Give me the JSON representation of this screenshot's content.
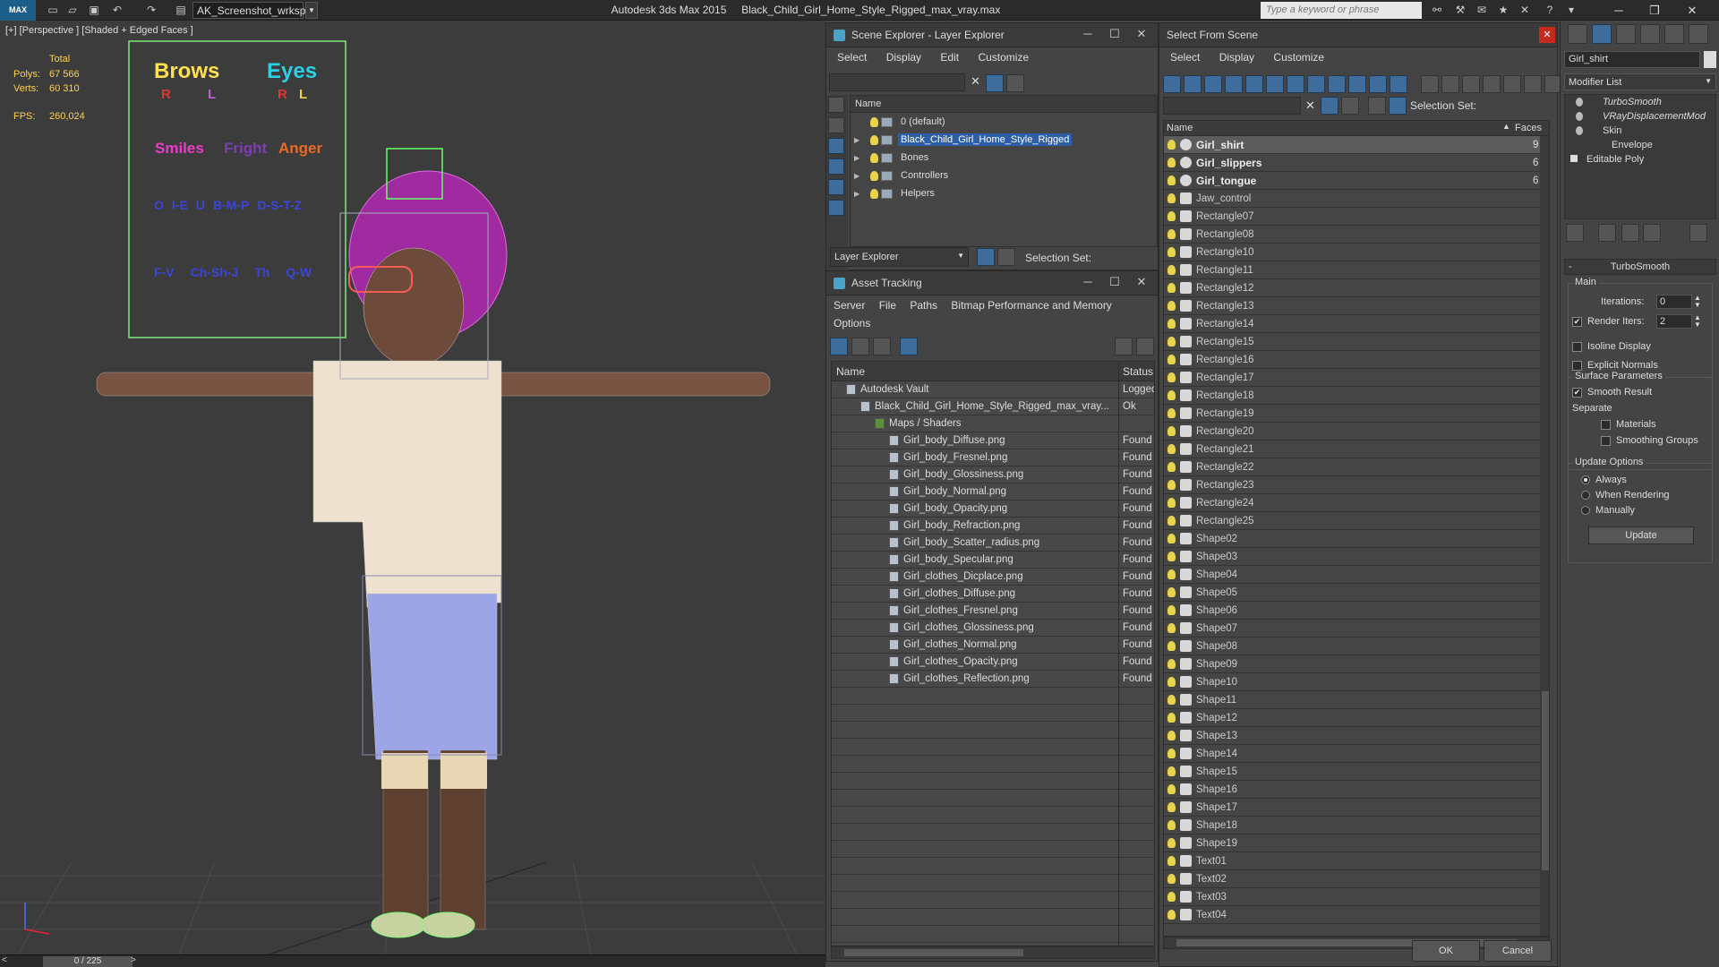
{
  "titlebar": {
    "logo": "MAX",
    "workspace": "AK_Screenshot_wrksp",
    "app_name": "Autodesk 3ds Max  2015",
    "file_name": "Black_Child_Girl_Home_Style_Rigged_max_vray.max",
    "search_placeholder": "Type a keyword or phrase"
  },
  "viewport": {
    "label": "[+] [Perspective ] [Shaded + Edged Faces ]",
    "stats": {
      "total_label": "Total",
      "polys_label": "Polys:",
      "polys_value": "67 566",
      "verts_label": "Verts:",
      "verts_value": "60 310",
      "fps_label": "FPS:",
      "fps_value": "260,024"
    },
    "facial_board": {
      "brows": "Brows",
      "eyes": "Eyes",
      "brows_r": "R",
      "brows_l": "L",
      "eyes_r": "R",
      "eyes_l": "L",
      "smiles": "Smiles",
      "fright": "Fright",
      "anger": "Anger",
      "phon1": [
        "O",
        "I-E",
        "U",
        "B-M-P",
        "D-S-T-Z"
      ],
      "phon2": [
        "F-V",
        "Ch-Sh-J",
        "Th",
        "Q-W"
      ]
    },
    "timeline": "0 / 225"
  },
  "scene_explorer": {
    "title": "Scene Explorer - Layer Explorer",
    "menu": [
      "Select",
      "Display",
      "Edit",
      "Customize"
    ],
    "col_name": "Name",
    "layers": [
      {
        "name": "0 (default)",
        "selected": false,
        "expandable": false
      },
      {
        "name": "Black_Child_Girl_Home_Style_Rigged",
        "selected": true,
        "expandable": true
      },
      {
        "name": "Bones",
        "selected": false,
        "expandable": true
      },
      {
        "name": "Controllers",
        "selected": false,
        "expandable": true
      },
      {
        "name": "Helpers",
        "selected": false,
        "expandable": true
      }
    ],
    "footer_dropdown": "Layer Explorer",
    "selection_set": "Selection Set:"
  },
  "asset_tracking": {
    "title": "Asset Tracking",
    "menu": [
      "Server",
      "File",
      "Paths",
      "Bitmap Performance and Memory"
    ],
    "menu2": [
      "Options"
    ],
    "col_name": "Name",
    "col_status": "Status",
    "rows": [
      {
        "name": "Autodesk Vault",
        "status": "Logged",
        "indent": 1
      },
      {
        "name": "Black_Child_Girl_Home_Style_Rigged_max_vray...",
        "status": "Ok",
        "indent": 2
      },
      {
        "name": "Maps / Shaders",
        "status": "",
        "indent": 3
      },
      {
        "name": "Girl_body_Diffuse.png",
        "status": "Found",
        "indent": 4
      },
      {
        "name": "Girl_body_Fresnel.png",
        "status": "Found",
        "indent": 4
      },
      {
        "name": "Girl_body_Glossiness.png",
        "status": "Found",
        "indent": 4
      },
      {
        "name": "Girl_body_Normal.png",
        "status": "Found",
        "indent": 4
      },
      {
        "name": "Girl_body_Opacity.png",
        "status": "Found",
        "indent": 4
      },
      {
        "name": "Girl_body_Refraction.png",
        "status": "Found",
        "indent": 4
      },
      {
        "name": "Girl_body_Scatter_radius.png",
        "status": "Found",
        "indent": 4
      },
      {
        "name": "Girl_body_Specular.png",
        "status": "Found",
        "indent": 4
      },
      {
        "name": "Girl_clothes_Dicplace.png",
        "status": "Found",
        "indent": 4
      },
      {
        "name": "Girl_clothes_Diffuse.png",
        "status": "Found",
        "indent": 4
      },
      {
        "name": "Girl_clothes_Fresnel.png",
        "status": "Found",
        "indent": 4
      },
      {
        "name": "Girl_clothes_Glossiness.png",
        "status": "Found",
        "indent": 4
      },
      {
        "name": "Girl_clothes_Normal.png",
        "status": "Found",
        "indent": 4
      },
      {
        "name": "Girl_clothes_Opacity.png",
        "status": "Found",
        "indent": 4
      },
      {
        "name": "Girl_clothes_Reflection.png",
        "status": "Found",
        "indent": 4
      }
    ]
  },
  "select_from_scene": {
    "title": "Select From Scene",
    "menu": [
      "Select",
      "Display",
      "Customize"
    ],
    "selection_set": "Selection Set:",
    "col_name": "Name",
    "col_faces": "Faces",
    "items": [
      {
        "name": "Girl_shirt",
        "faces": "9",
        "bold": true,
        "selected": true
      },
      {
        "name": "Girl_slippers",
        "faces": "6",
        "bold": true
      },
      {
        "name": "Girl_tongue",
        "faces": "6",
        "bold": true
      },
      {
        "name": "Jaw_control"
      },
      {
        "name": "Rectangle07"
      },
      {
        "name": "Rectangle08"
      },
      {
        "name": "Rectangle10"
      },
      {
        "name": "Rectangle11"
      },
      {
        "name": "Rectangle12"
      },
      {
        "name": "Rectangle13"
      },
      {
        "name": "Rectangle14"
      },
      {
        "name": "Rectangle15"
      },
      {
        "name": "Rectangle16"
      },
      {
        "name": "Rectangle17"
      },
      {
        "name": "Rectangle18"
      },
      {
        "name": "Rectangle19"
      },
      {
        "name": "Rectangle20"
      },
      {
        "name": "Rectangle21"
      },
      {
        "name": "Rectangle22"
      },
      {
        "name": "Rectangle23"
      },
      {
        "name": "Rectangle24"
      },
      {
        "name": "Rectangle25"
      },
      {
        "name": "Shape02"
      },
      {
        "name": "Shape03"
      },
      {
        "name": "Shape04"
      },
      {
        "name": "Shape05"
      },
      {
        "name": "Shape06"
      },
      {
        "name": "Shape07"
      },
      {
        "name": "Shape08"
      },
      {
        "name": "Shape09"
      },
      {
        "name": "Shape10"
      },
      {
        "name": "Shape11"
      },
      {
        "name": "Shape12"
      },
      {
        "name": "Shape13"
      },
      {
        "name": "Shape14"
      },
      {
        "name": "Shape15"
      },
      {
        "name": "Shape16"
      },
      {
        "name": "Shape17"
      },
      {
        "name": "Shape18"
      },
      {
        "name": "Shape19"
      },
      {
        "name": "Text01"
      },
      {
        "name": "Text02"
      },
      {
        "name": "Text03"
      },
      {
        "name": "Text04"
      }
    ],
    "ok": "OK",
    "cancel": "Cancel"
  },
  "command_panel": {
    "object_name": "Girl_shirt",
    "modifier_list": "Modifier List",
    "stack": [
      {
        "name": "TurboSmooth",
        "italic": true
      },
      {
        "name": "VRayDisplacementMod",
        "italic": true
      },
      {
        "name": "Skin",
        "italic": false
      },
      {
        "name": "Envelope",
        "italic": false
      },
      {
        "name": "Editable Poly",
        "italic": false
      }
    ],
    "rollout_title": "TurboSmooth",
    "main_label": "Main",
    "iterations_label": "Iterations:",
    "iterations_value": "0",
    "render_iters_label": "Render Iters:",
    "render_iters_value": "2",
    "isoline": "Isoline Display",
    "explicit_normals": "Explicit Normals",
    "surface_params": "Surface Parameters",
    "smooth_result": "Smooth Result",
    "separate": "Separate",
    "materials": "Materials",
    "smoothing_groups": "Smoothing Groups",
    "update_options": "Update Options",
    "always": "Always",
    "when_rendering": "When Rendering",
    "manually": "Manually",
    "update_btn": "Update"
  }
}
